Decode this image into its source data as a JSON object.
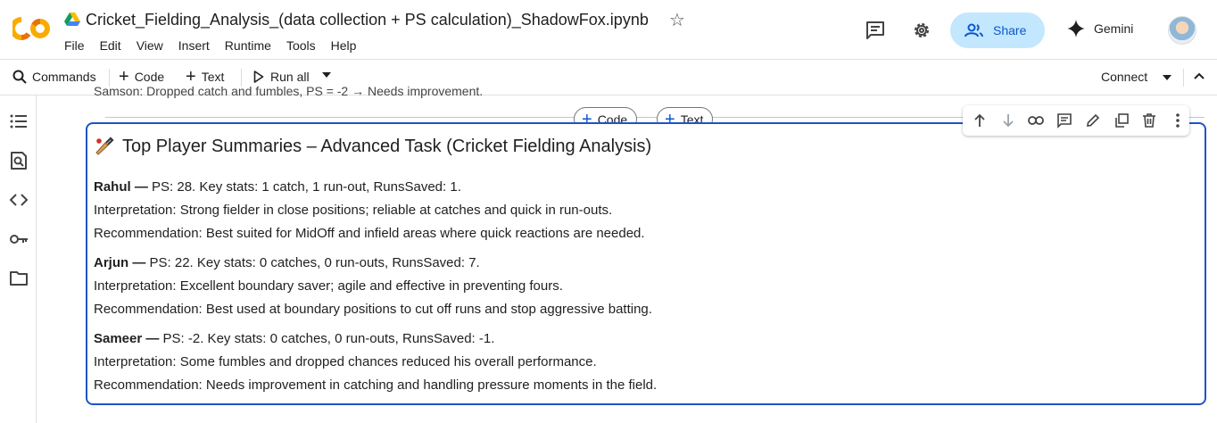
{
  "header": {
    "title": "Cricket_Fielding_Analysis_(data collection + PS calculation)_ShadowFox.ipynb",
    "menu": [
      "File",
      "Edit",
      "View",
      "Insert",
      "Runtime",
      "Tools",
      "Help"
    ],
    "share_label": "Share",
    "gemini_label": "Gemini"
  },
  "toolbar": {
    "commands_label": "Commands",
    "code_label": "Code",
    "text_label": "Text",
    "run_all_label": "Run all",
    "connect_label": "Connect"
  },
  "insert": {
    "code_label": "Code",
    "text_label": "Text"
  },
  "previous_cell_text": "Samson: Dropped catch and fumbles, PS = -2 → Needs improvement.",
  "cell": {
    "heading": "Top Player Summaries – Advanced Task (Cricket Fielding Analysis)",
    "players": [
      {
        "name": "Rahul —",
        "stats": " PS: 28. Key stats: 1 catch, 1 run-out, RunsSaved: 1.",
        "interpretation": "Interpretation: Strong fielder in close positions; reliable at catches and quick in run-outs.",
        "recommendation": "Recommendation: Best suited for MidOff and infield areas where quick reactions are needed."
      },
      {
        "name": "Arjun —",
        "stats": " PS: 22. Key stats: 0 catches, 0 run-outs, RunsSaved: 7.",
        "interpretation": "Interpretation: Excellent boundary saver; agile and effective in preventing fours.",
        "recommendation": "Recommendation: Best used at boundary positions to cut off runs and stop aggressive batting."
      },
      {
        "name": "Sameer —",
        "stats": " PS: -2. Key stats: 0 catches, 0 run-outs, RunsSaved: -1.",
        "interpretation": "Interpretation: Some fumbles and dropped chances reduced his overall performance.",
        "recommendation": "Recommendation: Needs improvement in catching and handling pressure moments in the field."
      }
    ]
  },
  "colors": {
    "accent": "#0b57d0",
    "share_bg": "#c2e7ff",
    "cell_border": "#1a56c4",
    "logo_orange": "#f9ab00",
    "logo_dark_orange": "#e8710a"
  },
  "icons": {
    "header": [
      "comment-icon",
      "settings-icon",
      "share-people-icon",
      "gemini-spark-icon"
    ],
    "rail": [
      "table-of-contents-icon",
      "find-icon",
      "code-snippets-icon",
      "secrets-key-icon",
      "files-folder-icon"
    ],
    "cell_toolbar": [
      "move-up-icon",
      "move-down-icon",
      "link-icon",
      "comment-icon",
      "edit-icon",
      "mirror-cell-icon",
      "delete-icon",
      "more-icon"
    ]
  }
}
